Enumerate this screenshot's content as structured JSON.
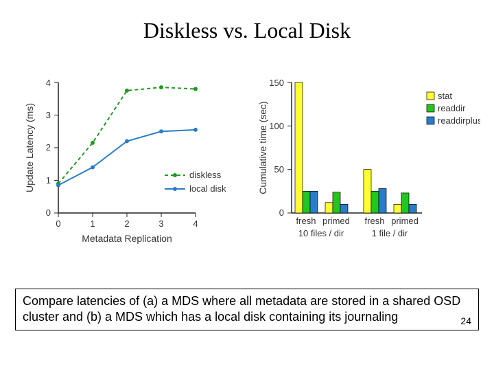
{
  "title": "Diskless vs. Local Disk",
  "caption": "Compare latencies of (a) a MDS where all metadata are stored in a shared OSD cluster and (b) a MDS which has a local disk containing its journaling",
  "slide_number": "24",
  "chart_data": [
    {
      "type": "line",
      "title": "",
      "xlabel": "Metadata Replication",
      "ylabel": "Update Latency (ms)",
      "x": [
        0,
        1,
        2,
        3,
        4
      ],
      "xlim": [
        0,
        4
      ],
      "ylim": [
        0,
        4
      ],
      "series": [
        {
          "name": "diskless",
          "color": "#1f9a1f",
          "style": "dashed",
          "values": [
            0.9,
            2.15,
            3.75,
            3.85,
            3.8
          ]
        },
        {
          "name": "local disk",
          "color": "#2a7cc8",
          "style": "solid",
          "values": [
            0.85,
            1.4,
            2.2,
            2.5,
            2.55
          ]
        }
      ],
      "legend_position": "right"
    },
    {
      "type": "bar",
      "title": "",
      "xlabel": "",
      "ylabel": "Cumulative time (sec)",
      "ylim": [
        0,
        150
      ],
      "yticks": [
        0,
        50,
        100,
        150
      ],
      "groups": [
        {
          "label": "fresh",
          "sublabel": "10 files / dir"
        },
        {
          "label": "primed",
          "sublabel": "10 files / dir"
        },
        {
          "label": "fresh",
          "sublabel": "1 file / dir"
        },
        {
          "label": "primed",
          "sublabel": "1 file / dir"
        }
      ],
      "series": [
        {
          "name": "stat",
          "color": "#ffff33",
          "values": [
            150,
            12,
            50,
            10
          ]
        },
        {
          "name": "readdir",
          "color": "#1fc71f",
          "values": [
            25,
            24,
            25,
            23
          ]
        },
        {
          "name": "readdirplus",
          "color": "#2a7cc8",
          "values": [
            25,
            10,
            28,
            10
          ]
        }
      ],
      "x_group_labels": [
        "10 files / dir",
        "1 file / dir"
      ],
      "x_cond_labels": [
        "fresh",
        "primed",
        "fresh",
        "primed"
      ],
      "legend_position": "right"
    }
  ]
}
